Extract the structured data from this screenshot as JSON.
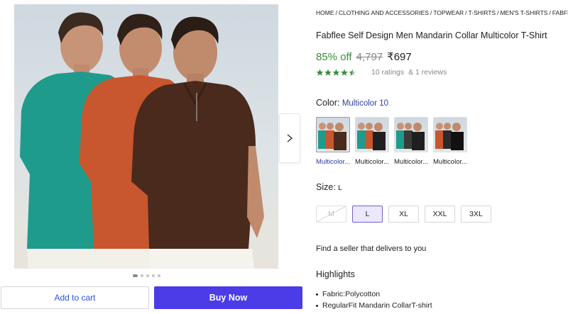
{
  "breadcrumb": [
    "HOME",
    "CLOTHING AND ACCESSORIES",
    "TOPWEAR",
    "T-SHIRTS",
    "MEN'S T-SHIRTS",
    "FABFLEE MEN"
  ],
  "product": {
    "title": "Fabflee Self Design Men Mandarin Collar Multicolor T-Shirt",
    "discount": "85% off",
    "mrp": "4,797",
    "price": "₹697",
    "rating_value": 4.5,
    "ratings_text": "10 ratings",
    "reviews_text": "& 1 reviews"
  },
  "color": {
    "label": "Color:",
    "selected_value": "Multicolor 10",
    "options": [
      {
        "label": "Multicolor...",
        "selected": true
      },
      {
        "label": "Multicolor...",
        "selected": false
      },
      {
        "label": "Multicolor...",
        "selected": false
      },
      {
        "label": "Multicolor...",
        "selected": false
      }
    ]
  },
  "size": {
    "label": "Size:",
    "selected_value": "L",
    "options": [
      {
        "label": "M",
        "state": "disabled"
      },
      {
        "label": "L",
        "state": "selected"
      },
      {
        "label": "XL",
        "state": "available"
      },
      {
        "label": "XXL",
        "state": "available"
      },
      {
        "label": "3XL",
        "state": "available"
      }
    ]
  },
  "seller": {
    "text": "Find a seller that delivers to you"
  },
  "highlights": {
    "title": "Highlights",
    "items": [
      "Fabric:Polycotton",
      "RegularFit Mandarin CollarT-shirt"
    ]
  },
  "actions": {
    "add_to_cart": "Add to cart",
    "buy_now": "Buy Now"
  },
  "gallery": {
    "image_count": 5,
    "active_index": 0
  },
  "colors": {
    "discount_green": "#388e3c",
    "buy_button": "#4b3ce8",
    "star_green": "#388e3c",
    "teal_shirt": "#1f9b8c",
    "orange_shirt": "#c8562e",
    "brown_shirt": "#4a2a1c"
  }
}
